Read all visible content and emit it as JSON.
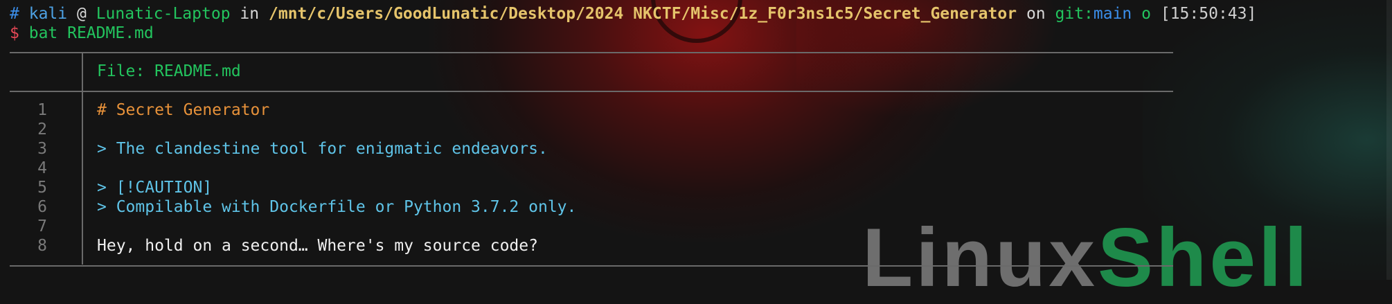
{
  "prompt": {
    "hash": "#",
    "user": "kali",
    "at": "@",
    "host": "Lunatic-Laptop",
    "in": "in",
    "path": "/mnt/c/Users/GoodLunatic/Desktop/2024 NKCTF/Misc/1z_F0r3ns1c5/Secret_Generator",
    "on": "on",
    "git_label": "git:",
    "branch": "main",
    "status_mark": "o",
    "time": "[15:50:43]"
  },
  "command": {
    "dollar": "$",
    "text": "bat README.md"
  },
  "bat": {
    "header": "File: README.md",
    "lines": [
      {
        "num": "1",
        "text": "# Secret Generator"
      },
      {
        "num": "2",
        "text": ""
      },
      {
        "num": "3",
        "text": "> The clandestine tool for enigmatic endeavors."
      },
      {
        "num": "4",
        "text": ""
      },
      {
        "num": "5",
        "text": "> [!CAUTION]"
      },
      {
        "num": "6",
        "text": "> Compilable with Dockerfile or Python 3.7.2 only."
      },
      {
        "num": "7",
        "text": ""
      },
      {
        "num": "8",
        "text": "Hey, hold on a second… Where's my source code?"
      }
    ]
  },
  "background": {
    "watermark_part1": "Linux",
    "watermark_part2": "Shell"
  },
  "colors": {
    "background": "#141414",
    "green": "#23c45e",
    "blue": "#3b8eea",
    "yellow": "#e5c46b",
    "heading": "#e8923a",
    "quote": "#5fc4e8"
  }
}
